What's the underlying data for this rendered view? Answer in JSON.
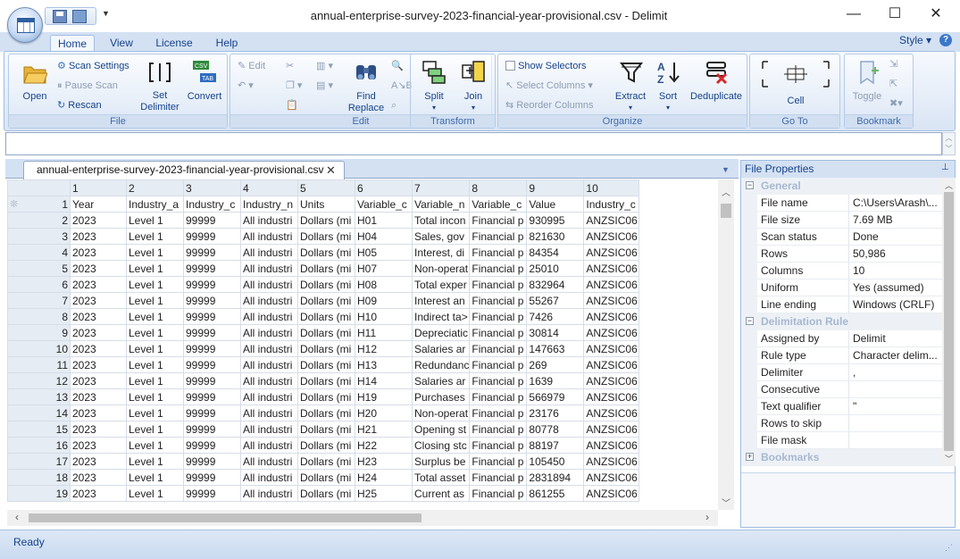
{
  "window": {
    "title": "annual-enterprise-survey-2023-financial-year-provisional.csv - Delimit"
  },
  "ribbon": {
    "tabs": [
      "Home",
      "View",
      "License",
      "Help"
    ],
    "style_label": "Style",
    "groups": {
      "file": {
        "label": "File",
        "open": "Open",
        "scan_settings": "Scan Settings",
        "pause_scan": "Pause Scan",
        "rescan": "Rescan",
        "set_delimiter_1": "Set",
        "set_delimiter_2": "Delimiter",
        "convert": "Convert"
      },
      "edit": {
        "label": "Edit",
        "edit": "Edit",
        "find_replace_1": "Find",
        "find_replace_2": "Replace"
      },
      "transform": {
        "label": "Transform",
        "split": "Split",
        "join": "Join"
      },
      "organize": {
        "label": "Organize",
        "show_selectors": "Show Selectors",
        "select_columns": "Select Columns",
        "reorder_columns": "Reorder Columns",
        "extract": "Extract",
        "sort": "Sort",
        "deduplicate": "Deduplicate"
      },
      "goto": {
        "label": "Go To",
        "cell": "Cell"
      },
      "bookmark": {
        "label": "Bookmark",
        "toggle": "Toggle"
      }
    }
  },
  "document_tab": {
    "label": "annual-enterprise-survey-2023-financial-year-provisional.csv"
  },
  "grid": {
    "column_headers": [
      "1",
      "2",
      "3",
      "4",
      "5",
      "6",
      "7",
      "8",
      "9",
      "10"
    ],
    "rows": [
      {
        "n": "1",
        "cells": [
          "Year",
          "Industry_a",
          "Industry_c",
          "Industry_n",
          "Units",
          "Variable_c",
          "Variable_n",
          "Variable_c",
          "Value",
          "Industry_c"
        ]
      },
      {
        "n": "2",
        "cells": [
          "2023",
          "Level 1",
          "99999",
          "All industri",
          "Dollars (mi",
          "H01",
          "Total incon",
          "Financial p",
          "930995",
          "ANZSIC06"
        ]
      },
      {
        "n": "3",
        "cells": [
          "2023",
          "Level 1",
          "99999",
          "All industri",
          "Dollars (mi",
          "H04",
          "Sales, gov",
          "Financial p",
          "821630",
          "ANZSIC06"
        ]
      },
      {
        "n": "4",
        "cells": [
          "2023",
          "Level 1",
          "99999",
          "All industri",
          "Dollars (mi",
          "H05",
          "Interest, di",
          "Financial p",
          "84354",
          "ANZSIC06"
        ]
      },
      {
        "n": "5",
        "cells": [
          "2023",
          "Level 1",
          "99999",
          "All industri",
          "Dollars (mi",
          "H07",
          "Non-operat",
          "Financial p",
          "25010",
          "ANZSIC06"
        ]
      },
      {
        "n": "6",
        "cells": [
          "2023",
          "Level 1",
          "99999",
          "All industri",
          "Dollars (mi",
          "H08",
          "Total exper",
          "Financial p",
          "832964",
          "ANZSIC06"
        ]
      },
      {
        "n": "7",
        "cells": [
          "2023",
          "Level 1",
          "99999",
          "All industri",
          "Dollars (mi",
          "H09",
          "Interest an",
          "Financial p",
          "55267",
          "ANZSIC06"
        ]
      },
      {
        "n": "8",
        "cells": [
          "2023",
          "Level 1",
          "99999",
          "All industri",
          "Dollars (mi",
          "H10",
          "Indirect ta>",
          "Financial p",
          "7426",
          "ANZSIC06"
        ]
      },
      {
        "n": "9",
        "cells": [
          "2023",
          "Level 1",
          "99999",
          "All industri",
          "Dollars (mi",
          "H11",
          "Depreciatic",
          "Financial p",
          "30814",
          "ANZSIC06"
        ]
      },
      {
        "n": "10",
        "cells": [
          "2023",
          "Level 1",
          "99999",
          "All industri",
          "Dollars (mi",
          "H12",
          "Salaries ar",
          "Financial p",
          "147663",
          "ANZSIC06"
        ]
      },
      {
        "n": "11",
        "cells": [
          "2023",
          "Level 1",
          "99999",
          "All industri",
          "Dollars (mi",
          "H13",
          "Redundanc",
          "Financial p",
          "269",
          "ANZSIC06"
        ]
      },
      {
        "n": "12",
        "cells": [
          "2023",
          "Level 1",
          "99999",
          "All industri",
          "Dollars (mi",
          "H14",
          "Salaries ar",
          "Financial p",
          "1639",
          "ANZSIC06"
        ]
      },
      {
        "n": "13",
        "cells": [
          "2023",
          "Level 1",
          "99999",
          "All industri",
          "Dollars (mi",
          "H19",
          "Purchases",
          "Financial p",
          "566979",
          "ANZSIC06"
        ]
      },
      {
        "n": "14",
        "cells": [
          "2023",
          "Level 1",
          "99999",
          "All industri",
          "Dollars (mi",
          "H20",
          "Non-operat",
          "Financial p",
          "23176",
          "ANZSIC06"
        ]
      },
      {
        "n": "15",
        "cells": [
          "2023",
          "Level 1",
          "99999",
          "All industri",
          "Dollars (mi",
          "H21",
          "Opening st",
          "Financial p",
          "80778",
          "ANZSIC06"
        ]
      },
      {
        "n": "16",
        "cells": [
          "2023",
          "Level 1",
          "99999",
          "All industri",
          "Dollars (mi",
          "H22",
          "Closing stc",
          "Financial p",
          "88197",
          "ANZSIC06"
        ]
      },
      {
        "n": "17",
        "cells": [
          "2023",
          "Level 1",
          "99999",
          "All industri",
          "Dollars (mi",
          "H23",
          "Surplus be",
          "Financial p",
          "105450",
          "ANZSIC06"
        ]
      },
      {
        "n": "18",
        "cells": [
          "2023",
          "Level 1",
          "99999",
          "All industri",
          "Dollars (mi",
          "H24",
          "Total asset",
          "Financial p",
          "2831894",
          "ANZSIC06"
        ]
      },
      {
        "n": "19",
        "cells": [
          "2023",
          "Level 1",
          "99999",
          "All industri",
          "Dollars (mi",
          "H25",
          "Current as",
          "Financial p",
          "861255",
          "ANZSIC06"
        ]
      }
    ]
  },
  "properties": {
    "title": "File Properties",
    "categories": {
      "general": "General",
      "delimitation": "Delimitation Rule",
      "bookmarks": "Bookmarks"
    },
    "general": [
      {
        "k": "File name",
        "v": "C:\\Users\\Arash\\..."
      },
      {
        "k": "File size",
        "v": "7.69 MB"
      },
      {
        "k": "Scan status",
        "v": "Done"
      },
      {
        "k": "Rows",
        "v": "50,986"
      },
      {
        "k": "Columns",
        "v": "10"
      },
      {
        "k": "Uniform",
        "v": "Yes (assumed)"
      },
      {
        "k": "Line ending",
        "v": "Windows (CRLF)"
      }
    ],
    "delimitation": [
      {
        "k": "Assigned by",
        "v": "Delimit"
      },
      {
        "k": "Rule type",
        "v": "Character delim..."
      },
      {
        "k": "Delimiter",
        "v": ","
      },
      {
        "k": "Consecutive",
        "v": ""
      },
      {
        "k": "Text qualifier",
        "v": "\""
      },
      {
        "k": "Rows to skip",
        "v": ""
      },
      {
        "k": "File mask",
        "v": ""
      }
    ]
  },
  "status": {
    "text": "Ready"
  },
  "colors": {
    "ribbon_text": "#15428b",
    "frame": "#d4e1f3",
    "accent": "#3c78c8"
  }
}
